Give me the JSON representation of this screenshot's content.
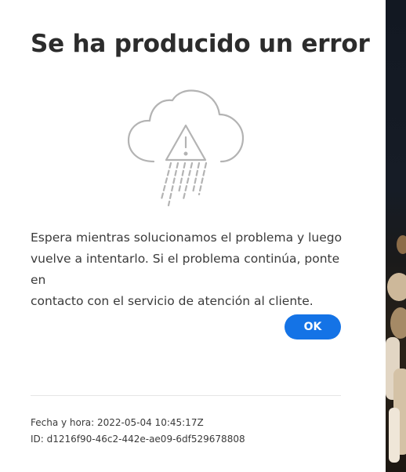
{
  "dialog": {
    "title": "Se ha producido un error",
    "illustration_icon": "cloud-warning-rain-icon",
    "message_lines": [
      "Espera mientras solucionamos el problema y luego",
      "vuelve a intentarlo. Si el problema continúa, ponte en",
      "contacto con el servicio de atención al cliente."
    ],
    "ok_label": "OK",
    "date_text": "Fecha y hora: 2022-05-04 10:45:17Z",
    "id_text": "ID: d1216f90-46c2-442e-ae09-6df529678808"
  },
  "colors": {
    "accent": "#1473e6",
    "title": "#2c2c2c",
    "illustration_stroke": "#b3b3b3",
    "divider": "#e6e6e6"
  }
}
